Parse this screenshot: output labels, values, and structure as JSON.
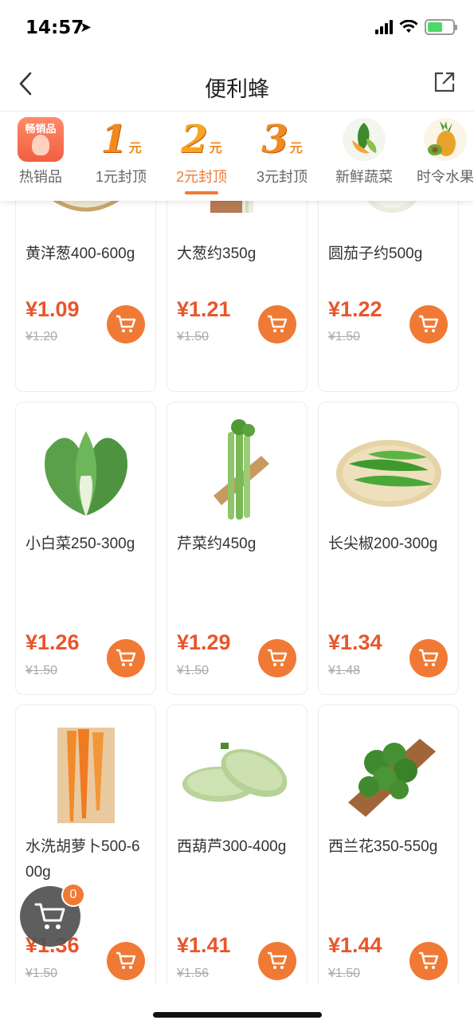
{
  "status_bar": {
    "time": "14:57",
    "location_icon": "location-arrow-icon",
    "signal_icon": "cellular-signal-icon",
    "wifi_icon": "wifi-icon",
    "battery_icon": "battery-charging-icon"
  },
  "nav": {
    "title": "便利蜂",
    "back_icon": "chevron-left-icon",
    "share_icon": "share-external-icon"
  },
  "categories": [
    {
      "label": "热销品",
      "badge_text": "畅销品",
      "icon": "hot-sale-icon"
    },
    {
      "label": "1元封顶",
      "num": "1",
      "unit": "元",
      "icon": "one-yuan-icon"
    },
    {
      "label": "2元封顶",
      "num": "2",
      "unit": "元",
      "icon": "two-yuan-icon",
      "active": true
    },
    {
      "label": "3元封顶",
      "num": "3",
      "unit": "元",
      "icon": "three-yuan-icon"
    },
    {
      "label": "新鲜蔬菜",
      "icon": "vegetables-icon"
    },
    {
      "label": "时令水果",
      "icon": "fruit-icon"
    }
  ],
  "products": [
    {
      "name": "黄洋葱400-600g",
      "price": "¥1.09",
      "original_price": "¥1.20",
      "image": "yellow-onion-image"
    },
    {
      "name": "大葱约350g",
      "price": "¥1.21",
      "original_price": "¥1.50",
      "image": "scallion-image"
    },
    {
      "name": "圆茄子约500g",
      "price": "¥1.22",
      "original_price": "¥1.50",
      "image": "eggplant-image"
    },
    {
      "name": "小白菜250-300g",
      "price": "¥1.26",
      "original_price": "¥1.50",
      "image": "bok-choy-image"
    },
    {
      "name": "芹菜约450g",
      "price": "¥1.29",
      "original_price": "¥1.50",
      "image": "celery-image"
    },
    {
      "name": "长尖椒200-300g",
      "price": "¥1.34",
      "original_price": "¥1.48",
      "image": "long-pepper-image"
    },
    {
      "name": "水洗胡萝卜500-600g",
      "price": "¥1.36",
      "original_price": "¥1.50",
      "image": "carrot-image"
    },
    {
      "name": "西葫芦300-400g",
      "price": "¥1.41",
      "original_price": "¥1.56",
      "image": "zucchini-image"
    },
    {
      "name": "西兰花350-550g",
      "price": "¥1.44",
      "original_price": "¥1.50",
      "image": "broccoli-image"
    }
  ],
  "floating_cart": {
    "count": "0",
    "icon": "shopping-cart-icon"
  },
  "colors": {
    "accent": "#f07a35",
    "price": "#e8562c"
  }
}
